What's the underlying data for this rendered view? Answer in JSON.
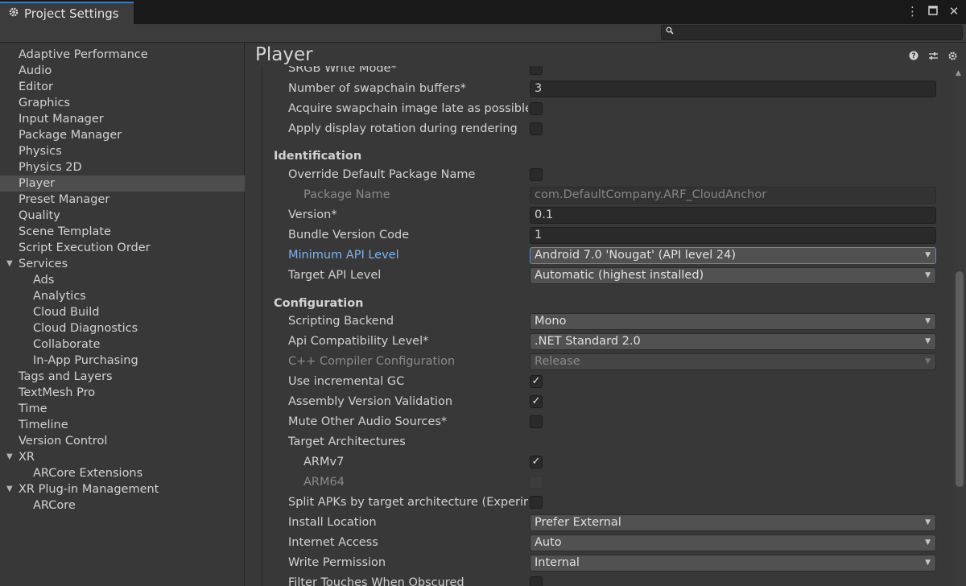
{
  "window": {
    "tab_title": "Project Settings",
    "search_placeholder": ""
  },
  "sidebar": {
    "items": [
      {
        "label": "Adaptive Performance",
        "level": 0
      },
      {
        "label": "Audio",
        "level": 0
      },
      {
        "label": "Editor",
        "level": 0
      },
      {
        "label": "Graphics",
        "level": 0
      },
      {
        "label": "Input Manager",
        "level": 0
      },
      {
        "label": "Package Manager",
        "level": 0
      },
      {
        "label": "Physics",
        "level": 0
      },
      {
        "label": "Physics 2D",
        "level": 0
      },
      {
        "label": "Player",
        "level": 0,
        "selected": true
      },
      {
        "label": "Preset Manager",
        "level": 0
      },
      {
        "label": "Quality",
        "level": 0
      },
      {
        "label": "Scene Template",
        "level": 0
      },
      {
        "label": "Script Execution Order",
        "level": 0
      },
      {
        "label": "Services",
        "level": 0,
        "expanded": true
      },
      {
        "label": "Ads",
        "level": 1
      },
      {
        "label": "Analytics",
        "level": 1
      },
      {
        "label": "Cloud Build",
        "level": 1
      },
      {
        "label": "Cloud Diagnostics",
        "level": 1
      },
      {
        "label": "Collaborate",
        "level": 1
      },
      {
        "label": "In-App Purchasing",
        "level": 1
      },
      {
        "label": "Tags and Layers",
        "level": 0
      },
      {
        "label": "TextMesh Pro",
        "level": 0
      },
      {
        "label": "Time",
        "level": 0
      },
      {
        "label": "Timeline",
        "level": 0
      },
      {
        "label": "Version Control",
        "level": 0
      },
      {
        "label": "XR",
        "level": 0,
        "expanded": true
      },
      {
        "label": "ARCore Extensions",
        "level": 1
      },
      {
        "label": "XR Plug-in Management",
        "level": 0,
        "expanded": true
      },
      {
        "label": "ARCore",
        "level": 1
      }
    ]
  },
  "main": {
    "title": "Player",
    "rows": [
      {
        "kind": "check",
        "label": "SRGB Write Mode*",
        "checked": false
      },
      {
        "kind": "field",
        "label": "Number of swapchain buffers*",
        "value": "3"
      },
      {
        "kind": "check",
        "label": "Acquire swapchain image late as possible",
        "checked": false
      },
      {
        "kind": "check",
        "label": "Apply display rotation during rendering",
        "checked": false
      },
      {
        "kind": "section",
        "label": "Identification"
      },
      {
        "kind": "check",
        "label": "Override Default Package Name",
        "checked": false
      },
      {
        "kind": "field",
        "label": "Package Name",
        "value": "com.DefaultCompany.ARF_CloudAnchor",
        "disabled": true,
        "indent": true
      },
      {
        "kind": "field",
        "label": "Version*",
        "value": "0.1"
      },
      {
        "kind": "field",
        "label": "Bundle Version Code",
        "value": "1"
      },
      {
        "kind": "dropdown",
        "label": "Minimum API Level",
        "value": "Android 7.0 'Nougat' (API level 24)",
        "focused": true
      },
      {
        "kind": "dropdown",
        "label": "Target API Level",
        "value": "Automatic (highest installed)"
      },
      {
        "kind": "section",
        "label": "Configuration"
      },
      {
        "kind": "dropdown",
        "label": "Scripting Backend",
        "value": "Mono"
      },
      {
        "kind": "dropdown",
        "label": "Api Compatibility Level*",
        "value": ".NET Standard 2.0"
      },
      {
        "kind": "dropdown",
        "label": "C++ Compiler Configuration",
        "value": "Release",
        "disabled": true
      },
      {
        "kind": "check",
        "label": "Use incremental GC",
        "checked": true
      },
      {
        "kind": "check",
        "label": "Assembly Version Validation",
        "checked": true
      },
      {
        "kind": "check",
        "label": "Mute Other Audio Sources*",
        "checked": false
      },
      {
        "kind": "label",
        "label": "Target Architectures"
      },
      {
        "kind": "check",
        "label": "ARMv7",
        "checked": true,
        "indent": true
      },
      {
        "kind": "check",
        "label": "ARM64",
        "checked": false,
        "disabled": true,
        "indent": true
      },
      {
        "kind": "check",
        "label": "Split APKs by target architecture (Experimental)",
        "checked": false
      },
      {
        "kind": "dropdown",
        "label": "Install Location",
        "value": "Prefer External"
      },
      {
        "kind": "dropdown",
        "label": "Internet Access",
        "value": "Auto"
      },
      {
        "kind": "dropdown",
        "label": "Write Permission",
        "value": "Internal"
      },
      {
        "kind": "check",
        "label": "Filter Touches When Obscured",
        "checked": false
      }
    ]
  },
  "icons": {
    "tab": "gear-icon",
    "menu": "kebab-menu-icon",
    "maximize": "maximize-icon",
    "close": "close-icon",
    "search": "search-icon",
    "help": "help-icon",
    "presets": "presets-icon",
    "settings": "settings-icon"
  },
  "colors": {
    "background": "#383838",
    "selected": "#4d4d4d",
    "link": "#7ab4f0",
    "focus": "#4c8ed8"
  }
}
